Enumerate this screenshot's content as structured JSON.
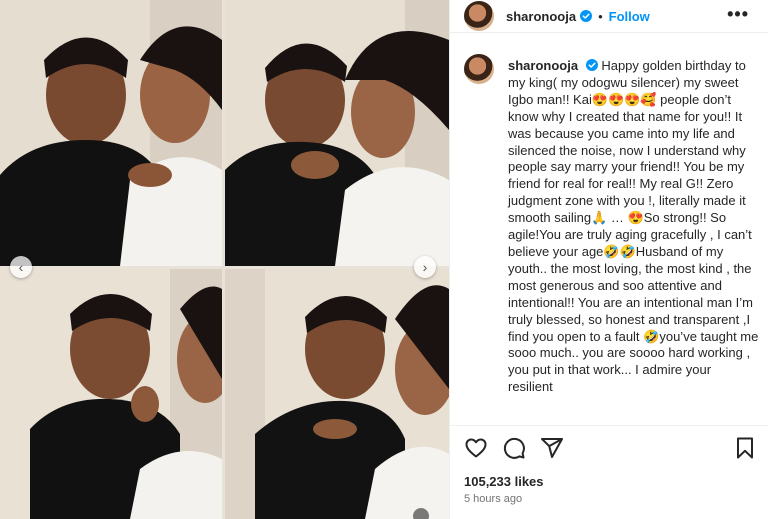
{
  "post": {
    "username": "sharonooja",
    "verified": true,
    "separator": "•",
    "follow_label": "Follow",
    "more_label": "•••",
    "caption": "Happy golden birthday to my king( my odogwu silencer) my sweet Igbo man!! Kai😍😍😍🥰 people don’t know why I created that name for you!! It was because you came into my life and silenced the noise, now I understand why people say marry your friend!! You be my friend for real for real!! My real G!! Zero judgment zone with you !, literally made it smooth sailing🙏 … 😍So strong!! So agile!You are truly aging gracefully , I can’t believe your age🤣🤣Husband of my youth.. the most loving, the most kind , the most generous and soo attentive and intentional!! You are an intentional man I’m truly blessed, so honest and transparent ,I find you open to a fault 🤣you’ve taught me sooo much.. you are soooo hard working , you put in that work... I admire your resilient",
    "likes": "105,233 likes",
    "time": "5 hours ago"
  },
  "media": {
    "images": [
      "couple-photo-1",
      "couple-photo-2",
      "couple-photo-3",
      "couple-photo-4"
    ],
    "nav_left": "‹",
    "nav_right": "›"
  },
  "colors": {
    "accent": "#0095f6",
    "text": "#262626",
    "muted": "#737373",
    "border": "#efefef"
  },
  "icons": [
    "heart-icon",
    "comment-icon",
    "share-icon",
    "bookmark-icon",
    "verified-icon"
  ]
}
